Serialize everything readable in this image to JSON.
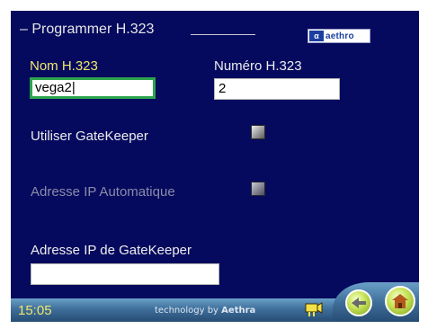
{
  "header": {
    "title": "Programmer H.323",
    "title_prefix": "–",
    "logo_text": "aethro",
    "logo_mark": "α"
  },
  "form": {
    "h323_name": {
      "label": "Nom H.323",
      "value": "vega2|"
    },
    "h323_number": {
      "label": "Numéro H.323",
      "value": "2"
    },
    "use_gatekeeper": {
      "label": "Utiliser GateKeeper"
    },
    "auto_ip": {
      "label": "Adresse IP Automatique"
    },
    "gatekeeper_ip": {
      "label": "Adresse IP de GateKeeper",
      "value": ""
    }
  },
  "footer": {
    "time": "15:05",
    "tech_prefix": "technology by",
    "tech_brand": "Aethra"
  },
  "colors": {
    "background": "#050a5e",
    "label_active": "#f1e86a",
    "focus_border": "#2da44e",
    "footer_bar": "#3f6f9b",
    "button_green": "#c9e55b"
  },
  "icons": [
    "camera-icon",
    "back-arrow-icon",
    "home-icon"
  ]
}
